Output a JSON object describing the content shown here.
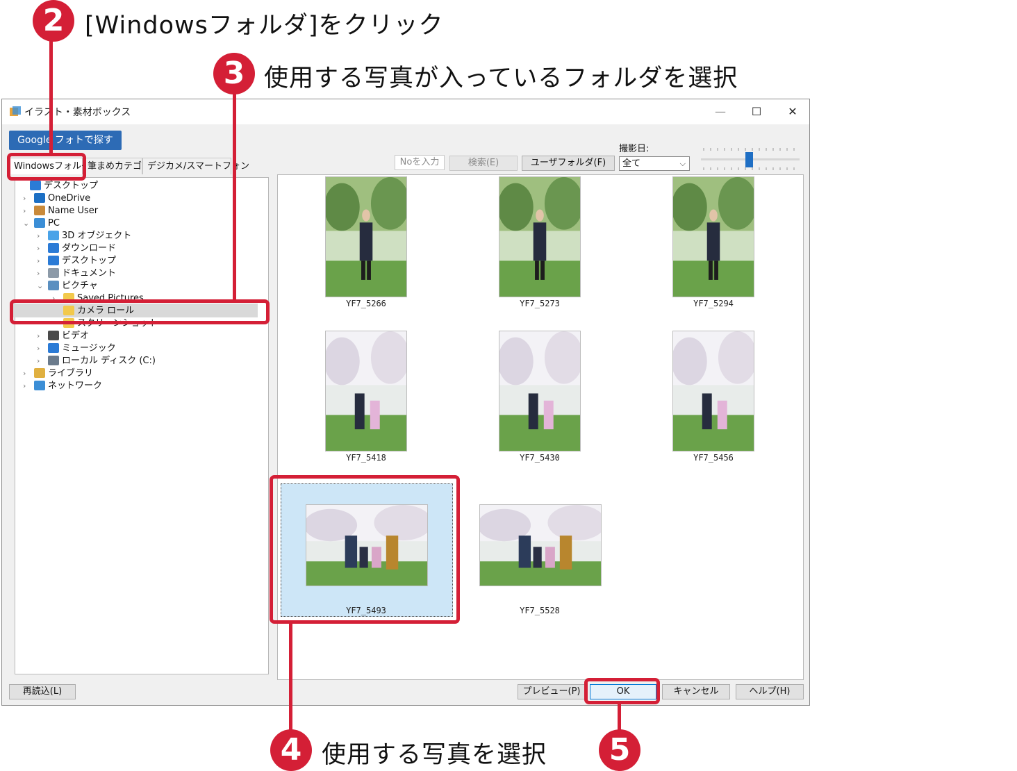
{
  "annotations": {
    "step2": {
      "num": "2",
      "text": "[Windowsフォルダ]をクリック"
    },
    "step3": {
      "num": "3",
      "text": "使用する写真が入っているフォルダを選択"
    },
    "step4": {
      "num": "4",
      "text": "使用する写真を選択"
    },
    "step5": {
      "num": "5"
    }
  },
  "window": {
    "title": "イラスト・素材ボックス",
    "controls": {
      "minimize": "—",
      "maximize": "☐",
      "close": "✕"
    }
  },
  "google_button": "Google フォトで探す",
  "tabs": [
    "Windowsフォルダ",
    "筆まめカテゴリ",
    "デジカメ/スマートフォン"
  ],
  "toolbar": {
    "no_input_placeholder": "Noを入力",
    "search": "検索(E)",
    "user_folder": "ユーザフォルダ(F)",
    "date_label": "撮影日:",
    "date_select": "全て"
  },
  "tree": [
    {
      "label": "デスクトップ",
      "icon": "desktop-icon",
      "color": "#2b7bd6"
    },
    {
      "label": "OneDrive",
      "icon": "cloud-icon",
      "color": "#1c6fc4"
    },
    {
      "label": "Name User",
      "icon": "user-icon",
      "color": "#c98a3a"
    },
    {
      "label": "PC",
      "icon": "monitor-icon",
      "color": "#3b8ed6"
    },
    {
      "label": "3D オブジェクト",
      "icon": "cube-icon",
      "color": "#4aa3e8"
    },
    {
      "label": "ダウンロード",
      "icon": "download-icon",
      "color": "#2b7bd6"
    },
    {
      "label": "デスクトップ",
      "icon": "desktop-icon",
      "color": "#2b7bd6"
    },
    {
      "label": "ドキュメント",
      "icon": "document-icon",
      "color": "#8c9aa8"
    },
    {
      "label": "ピクチャ",
      "icon": "pictures-icon",
      "color": "#5a8fc0"
    },
    {
      "label": "Saved Pictures",
      "icon": "folder-icon",
      "color": "#f2c94c"
    },
    {
      "label": "カメラ ロール",
      "icon": "folder-icon",
      "color": "#f2c94c"
    },
    {
      "label": "スクリーンショット",
      "icon": "folder-icon",
      "color": "#f2c94c"
    },
    {
      "label": "ビデオ",
      "icon": "video-icon",
      "color": "#4a4a4a"
    },
    {
      "label": "ミュージック",
      "icon": "music-icon",
      "color": "#2b7bd6"
    },
    {
      "label": "ローカル ディスク (C:)",
      "icon": "disk-icon",
      "color": "#6b7b8c"
    },
    {
      "label": "ライブラリ",
      "icon": "library-icon",
      "color": "#e0b040"
    },
    {
      "label": "ネットワーク",
      "icon": "network-icon",
      "color": "#3b8ed6"
    }
  ],
  "photos": [
    {
      "name": "YF7_5266"
    },
    {
      "name": "YF7_5273"
    },
    {
      "name": "YF7_5294"
    },
    {
      "name": "YF7_5418"
    },
    {
      "name": "YF7_5430"
    },
    {
      "name": "YF7_5456"
    },
    {
      "name": "YF7_5493"
    },
    {
      "name": "YF7_5528"
    }
  ],
  "footer": {
    "reload": "再読込(L)",
    "preview": "プレビュー(P)",
    "ok": "OK",
    "cancel": "キャンセル",
    "help": "ヘルプ(H)"
  },
  "colors": {
    "accent_red": "#d41f36",
    "google_blue": "#2d6bb5",
    "selection_blue": "#cde6f7"
  }
}
